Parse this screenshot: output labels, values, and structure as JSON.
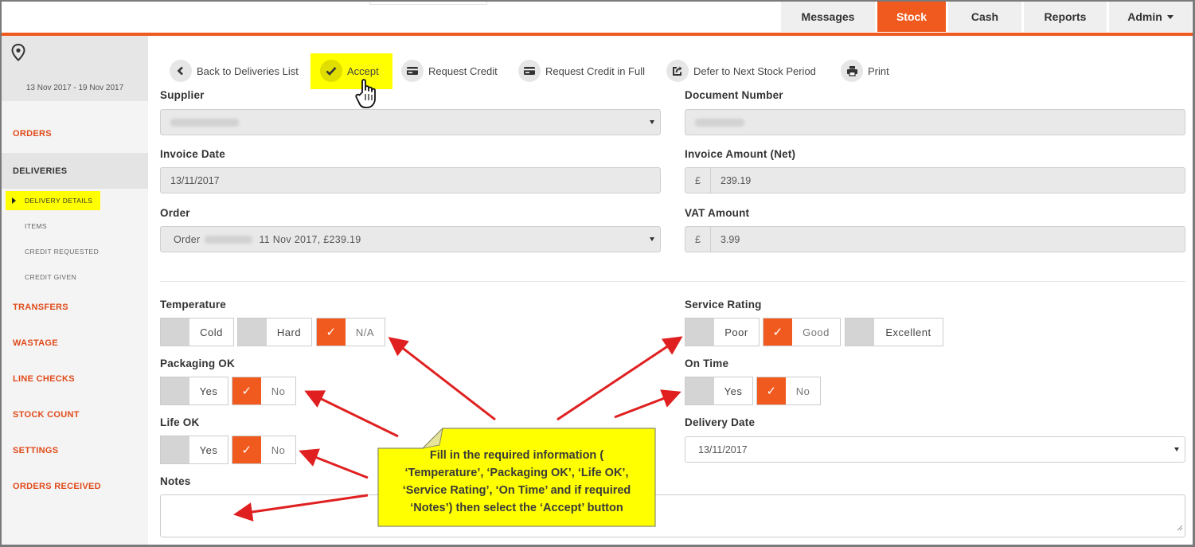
{
  "nav": {
    "tabs": [
      {
        "label": "Messages",
        "active": false
      },
      {
        "label": "Stock",
        "active": true
      },
      {
        "label": "Cash",
        "active": false
      },
      {
        "label": "Reports",
        "active": false
      },
      {
        "label": "Admin",
        "active": false
      }
    ]
  },
  "sidebar": {
    "date_range": "13 Nov 2017 - 19 Nov 2017",
    "items": {
      "orders": "ORDERS",
      "deliveries": "DELIVERIES",
      "delivery_details": "DELIVERY DETAILS",
      "items": "ITEMS",
      "credit_requested": "CREDIT REQUESTED",
      "credit_given": "CREDIT GIVEN",
      "transfers": "TRANSFERS",
      "wastage": "WASTAGE",
      "line_checks": "LINE CHECKS",
      "stock_count": "STOCK COUNT",
      "settings": "SETTINGS",
      "orders_received": "ORDERS RECEIVED"
    }
  },
  "toolbar": {
    "back": "Back to Deliveries List",
    "accept": "Accept",
    "request_credit": "Request Credit",
    "request_credit_full": "Request Credit in Full",
    "defer": "Defer to Next Stock Period",
    "print": "Print"
  },
  "form": {
    "supplier_label": "Supplier",
    "document_number_label": "Document Number",
    "invoice_date_label": "Invoice Date",
    "invoice_date_value": "13/11/2017",
    "invoice_amount_label": "Invoice Amount (Net)",
    "currency_symbol": "£",
    "invoice_amount_value": "239.19",
    "order_label": "Order",
    "order_prefix": "Order",
    "order_suffix": "11 Nov 2017, £239.19",
    "vat_label": "VAT Amount",
    "vat_value": "3.99",
    "temperature_label": "Temperature",
    "temperature_options": [
      "Cold",
      "Hard",
      "N/A"
    ],
    "temperature_selected": "N/A",
    "service_rating_label": "Service Rating",
    "service_rating_options": [
      "Poor",
      "Good",
      "Excellent"
    ],
    "service_rating_selected": "Good",
    "packaging_label": "Packaging OK",
    "packaging_options": [
      "Yes",
      "No"
    ],
    "packaging_selected": "No",
    "on_time_label": "On Time",
    "on_time_options": [
      "Yes",
      "No"
    ],
    "on_time_selected": "No",
    "life_label": "Life OK",
    "life_options": [
      "Yes",
      "No"
    ],
    "life_selected": "No",
    "delivery_date_label": "Delivery Date",
    "delivery_date_value": "13/11/2017",
    "notes_label": "Notes"
  },
  "callout": {
    "lines": [
      "Fill in the required information (",
      "‘Temperature’, ‘Packaging OK’, ‘Life OK’,",
      "‘Service Rating’, ‘On Time’ and if required",
      "‘Notes’) then select the ‘Accept’ button"
    ]
  },
  "colors": {
    "accent": "#f05a1e",
    "highlight": "#ffff00",
    "arrow": "#e02020"
  }
}
